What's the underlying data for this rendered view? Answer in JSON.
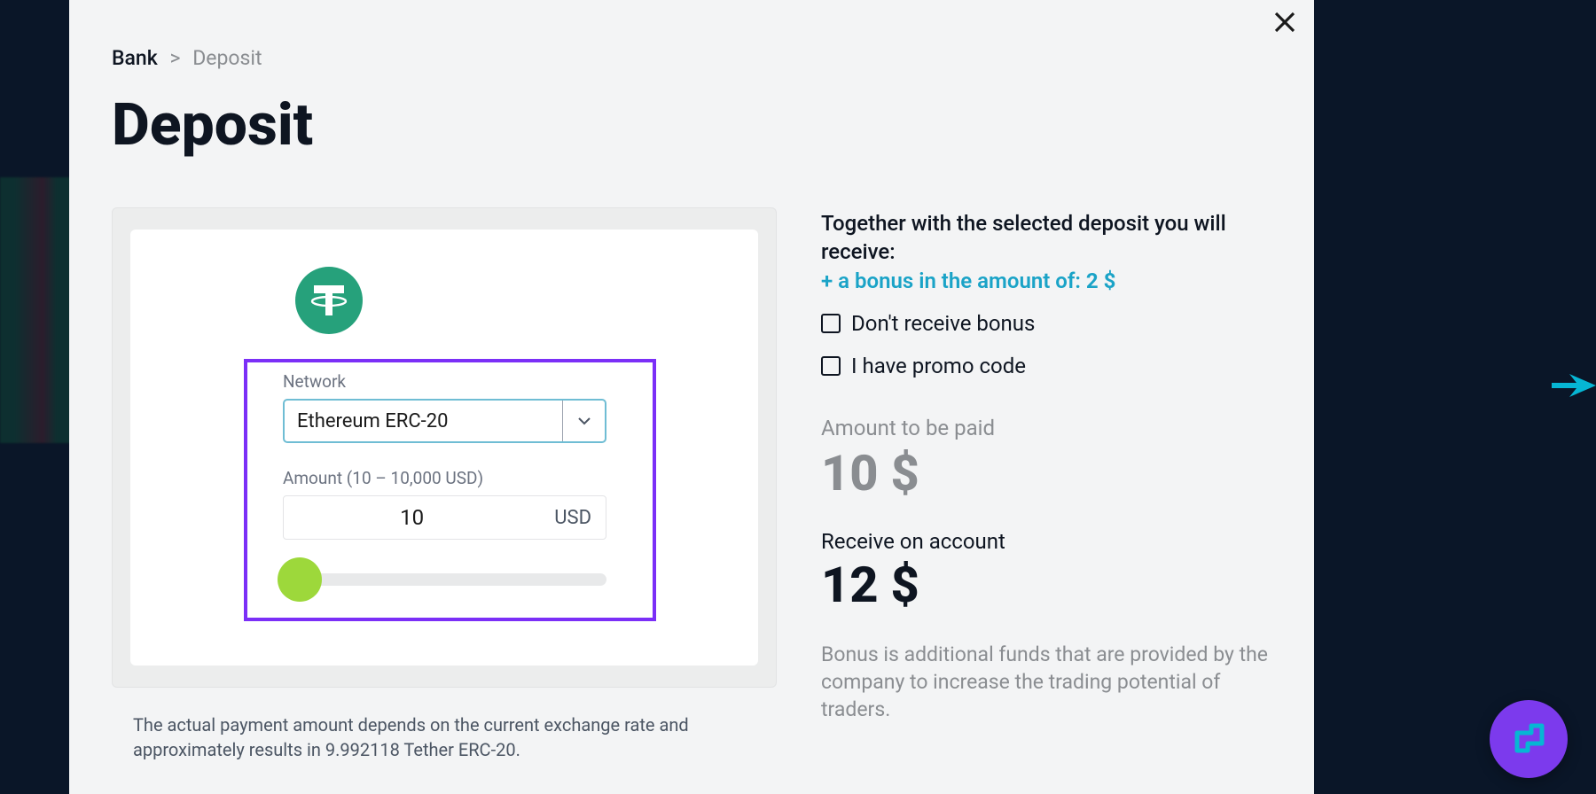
{
  "breadcrumb": {
    "root": "Bank",
    "current": "Deposit"
  },
  "page_title": "Deposit",
  "form": {
    "network_label": "Network",
    "network_value": "Ethereum ERC-20",
    "amount_label": "Amount (10 – 10,000 USD)",
    "amount_value": "10",
    "amount_currency": "USD"
  },
  "footnote": "The actual payment amount depends on the current exchange rate and approximately results in 9.992118 Tether ERC-20.",
  "summary": {
    "together_text": "Together with the selected deposit you will receive:",
    "bonus_prefix": "+ a bonus in the amount of: ",
    "bonus_amount": "2 $",
    "no_bonus_label": "Don't receive bonus",
    "promo_label": "I have promo code",
    "amount_paid_label": "Amount to be paid",
    "amount_paid_value": "10 $",
    "receive_label": "Receive on account",
    "receive_value": "12 $",
    "bonus_note": "Bonus is additional funds that are provided by the company to increase the trading potential of traders."
  }
}
